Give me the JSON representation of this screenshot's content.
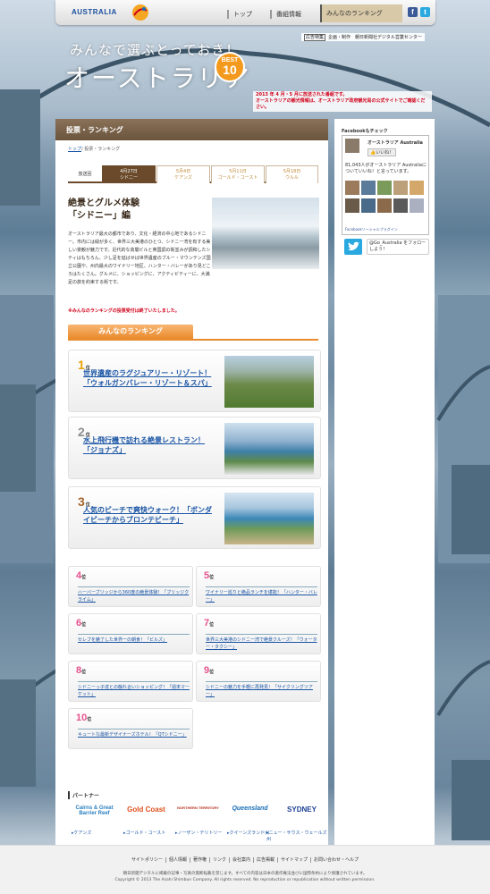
{
  "header": {
    "logo_text": "AUSTRALIA",
    "nav": [
      "トップ",
      "番組情報",
      "みんなのランキング"
    ],
    "social": [
      "f",
      "t"
    ],
    "credit_tag": "広告特集",
    "credit_text": "企画・制作　朝日新聞社デジタル営業センター",
    "hero_line1": "みんなで選ぶとっておき！",
    "hero_line2": "オーストラリア",
    "badge_top": "BEST",
    "badge_num": "10",
    "notice_line1": "2013 年 4 月・5 月に放送された番組です。",
    "notice_line2": "オーストラリアの観光情報は、オーストラリア政府観光局の公式サイトでご確認ください。"
  },
  "main": {
    "section_title": "投票・ランキング",
    "breadcrumb_home": "トップ",
    "breadcrumb_current": "/ 投票・ランキング",
    "tabs": [
      {
        "date": "放送回",
        "place": ""
      },
      {
        "date": "4月27日",
        "place": "シドニー"
      },
      {
        "date": "5月4日",
        "place": "ケアンズ"
      },
      {
        "date": "5月11日",
        "place": "ゴールド・コースト"
      },
      {
        "date": "5月18日",
        "place": "ウルル"
      }
    ],
    "heading_line1": "絶景とグルメ体験",
    "heading_line2": "「シドニー」編",
    "body": "オーストラリア最大の都市であり、文化・経済の中心地であるシドニー。市内には緑が多く、世界三大美港のひとつ、シドニー湾を有する美しい景観が魅力です。近代的な高層ビルと英国調の街並みが調和したシティはもちろん、少し足を延ばせば世界遺産のブルー・マウンテンズ国立公園や、州内最大のワイナリー地区、ハンター・バレーがあり見どころはたくさん。グルメに、ショッピングに、アクティビティーに、大満足の旅を約束する街です。",
    "closed_notice": "※みんなのランキングの投票受付は終了いたしました。",
    "ranking_title": "みんなのランキング",
    "rank_suffix": "位",
    "top3": [
      {
        "rank": "1",
        "title": "世界遺産のラグジュアリー・リゾート！「ウォルガンバレー・リゾート＆スパ」"
      },
      {
        "rank": "2",
        "title": "水上飛行機で訪れる絶景レストラン！「ジョナズ」"
      },
      {
        "rank": "3",
        "title": "人気のビーチで爽快ウォーク！「ボンダイビーチからブロンテビーチ」"
      }
    ],
    "others": [
      {
        "rank": "4",
        "title": "ハーバーブリッジから360度の絶景体験！「ブリッジクライム」"
      },
      {
        "rank": "5",
        "title": "ワイナリー巡りと絶品ランチを堪能！「ハンター・バレー」"
      },
      {
        "rank": "6",
        "title": "セレブを魅了した世界一の朝食！「ビルズ」"
      },
      {
        "rank": "7",
        "title": "世界三大美港のシドニー湾で絶景クルーズ！「ウォーター・タクシー」"
      },
      {
        "rank": "8",
        "title": "シドニーっ子達との触れ合いショッピング！「週末マーケット」"
      },
      {
        "rank": "9",
        "title": "シドニーの魅力を手軽に再発見！「サイクリングツアー」"
      },
      {
        "rank": "10",
        "title": "キュートな最新デザイナーズホテル！「QTシドニー」"
      }
    ],
    "partner_title": "パートナー",
    "partners": [
      {
        "logo": "Cairns & Great Barrier Reef",
        "link": "ケアンズ",
        "color": "#2a7fc0"
      },
      {
        "logo": "Gold Coast",
        "link": "ゴールド・コースト",
        "color": "#e1501e"
      },
      {
        "logo": "NORTHERN TERRITORY",
        "link": "ノーザン・テリトリー",
        "color": "#b5301f"
      },
      {
        "logo": "Queensland",
        "link": "クイーンズランド州",
        "color": "#1a6fb8"
      },
      {
        "logo": "SYDNEY",
        "link": "ニュー・サウス・ウェールズ州",
        "color": "#1c3f94"
      }
    ]
  },
  "sidebar": {
    "facebook_heading": "Facebookもチェック",
    "page_name": "オーストラリア Australia",
    "like_label": "いいね！",
    "count_text": "81,043人がオーストラリア Australiaについていいね！と言っています。",
    "plugin_label": "Facebookソーシャルプラグイン",
    "twitter_text": "@Go_Australia をフォローしよう！"
  },
  "footer": {
    "links": [
      "サイトポリシー",
      "個人情報",
      "著作権",
      "リンク",
      "会社案内",
      "広告掲載",
      "サイトマップ",
      "お問い合わせ・ヘルプ"
    ],
    "note1": "朝日新聞デジタルに掲載の記事・写真の無断転載を禁じます。すべての内容は日本の著作権法並びに国際条約により保護されています。",
    "note2": "Copyright © 2013 The Asahi Shimbun Company. All rights reserved. No reproduction or republication without written permission."
  },
  "colors": {
    "accent_orange": "#e98a2c",
    "brown": "#6a4a2a",
    "link_blue": "#1a55a5",
    "alert_red": "#d0021b",
    "rank1": "#e8a10a",
    "rank2": "#8d8d8d",
    "rank3": "#a5652b",
    "rank_other": "#e7518f"
  }
}
